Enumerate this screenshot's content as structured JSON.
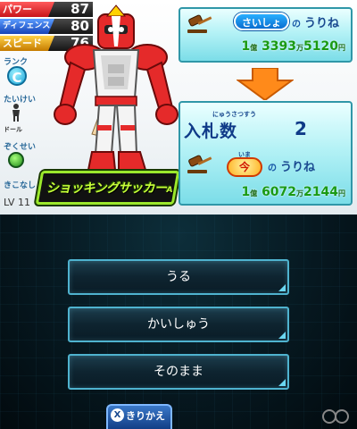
{
  "stats": [
    {
      "label": "パワー",
      "value": "87"
    },
    {
      "label": "ディフェンス",
      "value": "80"
    },
    {
      "label": "スピード",
      "value": "76"
    }
  ],
  "side_labels": {
    "rank": "ランク",
    "rank_value": "C",
    "body_type": "たいけい",
    "body_type_value": "ドール",
    "attribute": "ぞくせい",
    "kicks": "きこなし",
    "level": "LV 11"
  },
  "character": {
    "name": "ショッキングサッカー",
    "name_suffix": "A"
  },
  "first_price": {
    "pill": "さいしょ",
    "particle": "の",
    "label": "うりね",
    "oku": "1",
    "oku_unit": "億",
    "man": "3393",
    "man_unit": "万",
    "yen": "5120",
    "yen_unit": "円"
  },
  "bid": {
    "ruby": "にゅうさつすう",
    "label": "入札数",
    "count": "2"
  },
  "current_price": {
    "ruby": "いま",
    "now": "今",
    "particle": "の",
    "label": "うりね",
    "oku": "1",
    "oku_unit": "億",
    "man": "6072",
    "man_unit": "万",
    "yen": "2144",
    "yen_unit": "円"
  },
  "menu": {
    "sell": "うる",
    "collect": "かいしゅう",
    "keep": "そのまま",
    "switch": "きりかえ",
    "switch_key": "X"
  },
  "colors": {
    "price_green": "#1a9a14",
    "accent_cyan": "#4fb3cf",
    "name_green": "#c8ff3a"
  }
}
